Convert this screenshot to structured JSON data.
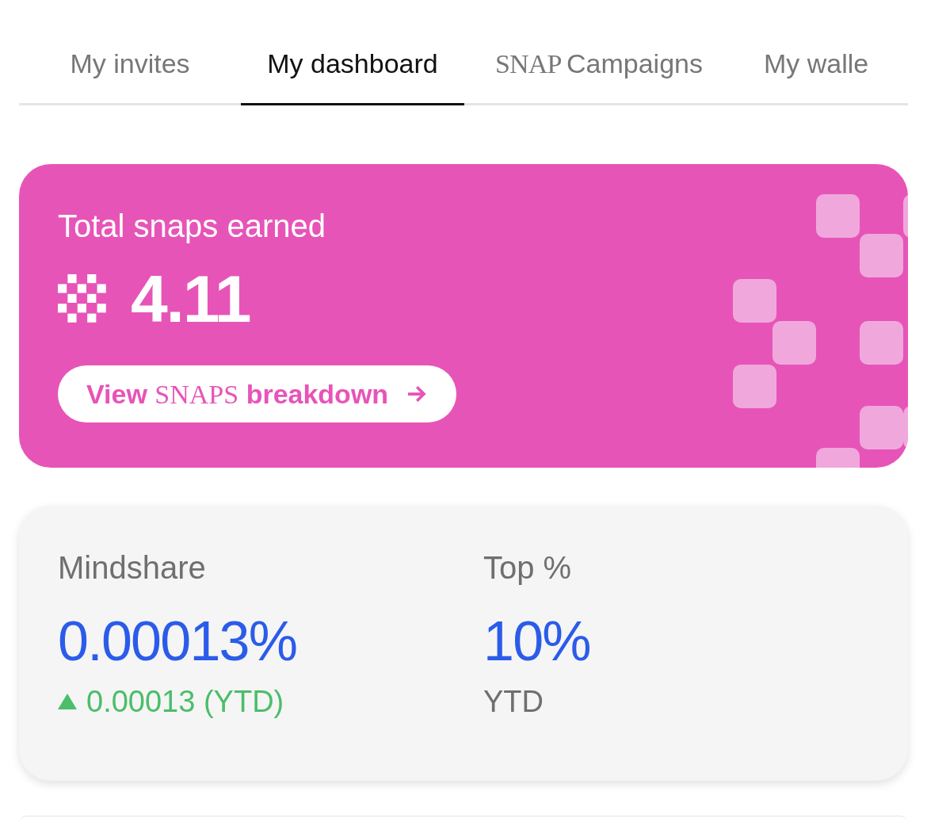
{
  "tabs": [
    {
      "label": "My invites",
      "selected": false
    },
    {
      "label": "My dashboard",
      "selected": true
    },
    {
      "brand": "SNAP",
      "label": "Campaigns",
      "selected": false
    },
    {
      "label": "My walle",
      "selected": false
    }
  ],
  "snaps_card": {
    "title": "Total snaps earned",
    "amount": "4.11",
    "button": {
      "before": "View",
      "brand": "SNAPS",
      "after": "breakdown"
    }
  },
  "stats": [
    {
      "label": "Mindshare",
      "value": "0.00013%",
      "sub": {
        "kind": "change",
        "rising": true,
        "text": "0.00013 (YTD)"
      }
    },
    {
      "label": "Top %",
      "value": "10%",
      "sub": {
        "kind": "note",
        "text": "YTD"
      }
    }
  ]
}
